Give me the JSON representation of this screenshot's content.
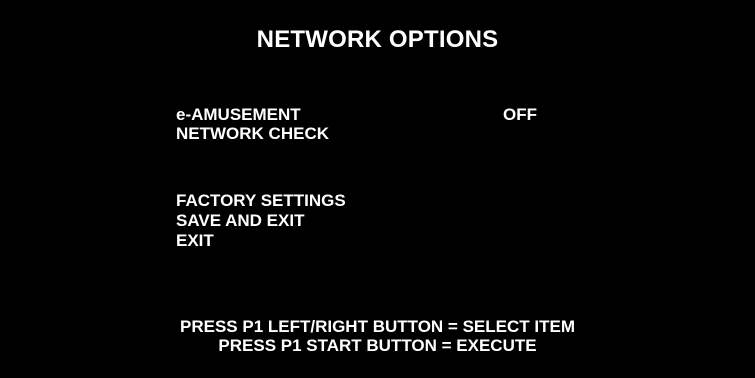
{
  "screen": {
    "title": "NETWORK OPTIONS",
    "menu": {
      "items": [
        {
          "label": "e-AMUSEMENT",
          "value": "OFF"
        },
        {
          "label": "NETWORK CHECK"
        },
        {
          "label": "FACTORY SETTINGS"
        },
        {
          "label": "SAVE AND EXIT"
        },
        {
          "label": "EXIT"
        }
      ]
    },
    "instructions": [
      "PRESS P1 LEFT/RIGHT BUTTON = SELECT ITEM",
      "PRESS P1 START BUTTON = EXECUTE"
    ],
    "colors": {
      "background": "#000000",
      "text": "#FFFFFF"
    }
  }
}
